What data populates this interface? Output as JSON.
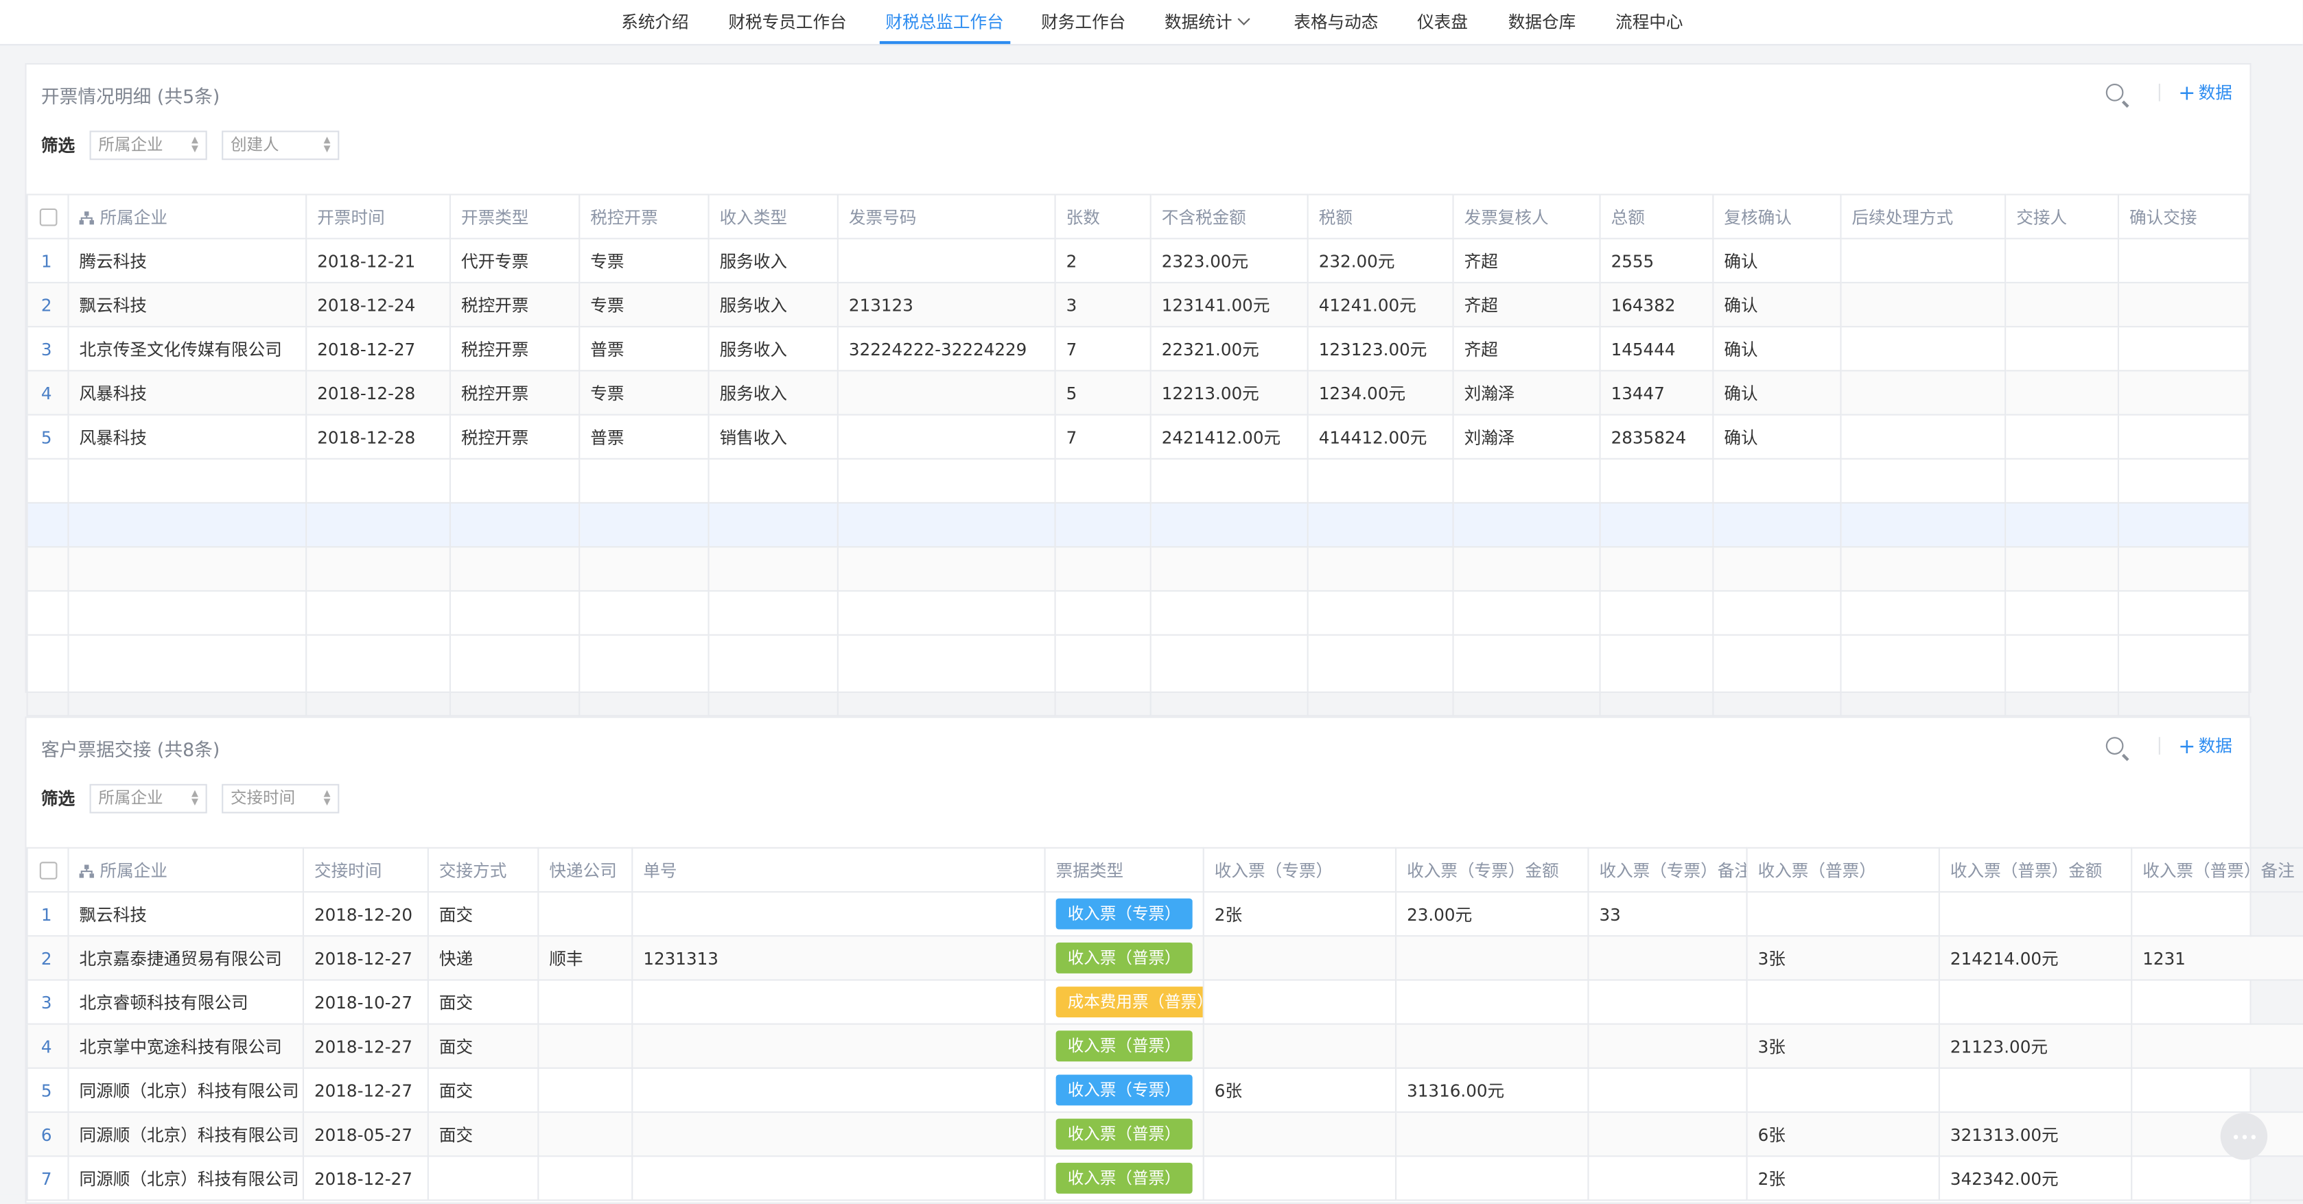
{
  "nav": {
    "items": [
      "系统介绍",
      "财税专员工作台",
      "财税总监工作台",
      "财务工作台",
      "数据统计",
      "表格与动态",
      "仪表盘",
      "数据仓库",
      "流程中心"
    ],
    "active": "财税总监工作台"
  },
  "panel1": {
    "title": "开票情况明细 (共5条)",
    "add_label": "数据",
    "filter_label": "筛选",
    "filters": [
      "所属企业",
      "创建人"
    ],
    "columns": [
      "所属企业",
      "开票时间",
      "开票类型",
      "税控开票",
      "收入类型",
      "发票号码",
      "张数",
      "不含税金额",
      "税额",
      "发票复核人",
      "总额",
      "复核确认",
      "后续处理方式",
      "交接人",
      "确认交接"
    ],
    "rows": [
      [
        "1",
        "腾云科技",
        "2018-12-21",
        "代开专票",
        "专票",
        "服务收入",
        "",
        "2",
        "2323.00元",
        "232.00元",
        "齐超",
        "2555",
        "确认",
        "",
        "",
        ""
      ],
      [
        "2",
        "飘云科技",
        "2018-12-24",
        "税控开票",
        "专票",
        "服务收入",
        "213123",
        "3",
        "123141.00元",
        "41241.00元",
        "齐超",
        "164382",
        "确认",
        "",
        "",
        ""
      ],
      [
        "3",
        "北京传圣文化传媒有限公司",
        "2018-12-27",
        "税控开票",
        "普票",
        "服务收入",
        "32224222-32224229",
        "7",
        "22321.00元",
        "123123.00元",
        "齐超",
        "145444",
        "确认",
        "",
        "",
        ""
      ],
      [
        "4",
        "风暴科技",
        "2018-12-28",
        "税控开票",
        "专票",
        "服务收入",
        "",
        "5",
        "12213.00元",
        "1234.00元",
        "刘瀚泽",
        "13447",
        "确认",
        "",
        "",
        ""
      ],
      [
        "5",
        "风暴科技",
        "2018-12-28",
        "税控开票",
        "普票",
        "销售收入",
        "",
        "7",
        "2421412.00元",
        "414412.00元",
        "刘瀚泽",
        "2835824",
        "确认",
        "",
        "",
        ""
      ]
    ]
  },
  "panel2": {
    "title": "客户票据交接 (共8条)",
    "add_label": "数据",
    "filter_label": "筛选",
    "filters": [
      "所属企业",
      "交接时间"
    ],
    "columns": [
      "所属企业",
      "交接时间",
      "交接方式",
      "快递公司",
      "单号",
      "票据类型",
      "收入票（专票）",
      "收入票（专票）金额",
      "收入票（专票）备注",
      "收入票（普票）",
      "收入票（普票）金额",
      "收入票（普票）备注"
    ],
    "rows": [
      [
        "1",
        "飘云科技",
        "2018-12-20",
        "面交",
        "",
        "",
        "收入票（专票）",
        "2张",
        "23.00元",
        "33",
        "",
        "",
        ""
      ],
      [
        "2",
        "北京嘉泰捷通贸易有限公司",
        "2018-12-27",
        "快递",
        "顺丰",
        "1231313",
        "收入票（普票）",
        "",
        "",
        "",
        "3张",
        "214214.00元",
        "1231"
      ],
      [
        "3",
        "北京睿顿科技有限公司",
        "2018-10-27",
        "面交",
        "",
        "",
        "成本费用票（普票）",
        "",
        "",
        "",
        "",
        "",
        ""
      ],
      [
        "4",
        "北京掌中宽途科技有限公司",
        "2018-12-27",
        "面交",
        "",
        "",
        "收入票（普票）",
        "",
        "",
        "",
        "3张",
        "21123.00元",
        ""
      ],
      [
        "5",
        "同源顺（北京）科技有限公司",
        "2018-12-27",
        "面交",
        "",
        "",
        "收入票（专票）",
        "6张",
        "31316.00元",
        "",
        "",
        "",
        ""
      ],
      [
        "6",
        "同源顺（北京）科技有限公司",
        "2018-05-27",
        "面交",
        "",
        "",
        "收入票（普票）",
        "",
        "",
        "",
        "6张",
        "321313.00元",
        ""
      ],
      [
        "7",
        "同源顺（北京）科技有限公司",
        "2018-12-27",
        "",
        "",
        "",
        "收入票（普票）",
        "",
        "",
        "",
        "2张",
        "342342.00元",
        ""
      ]
    ],
    "tag_colors": {
      "收入票（专票）": "blue",
      "收入票（普票）": "green",
      "成本费用票（普票）": "yellow"
    }
  }
}
